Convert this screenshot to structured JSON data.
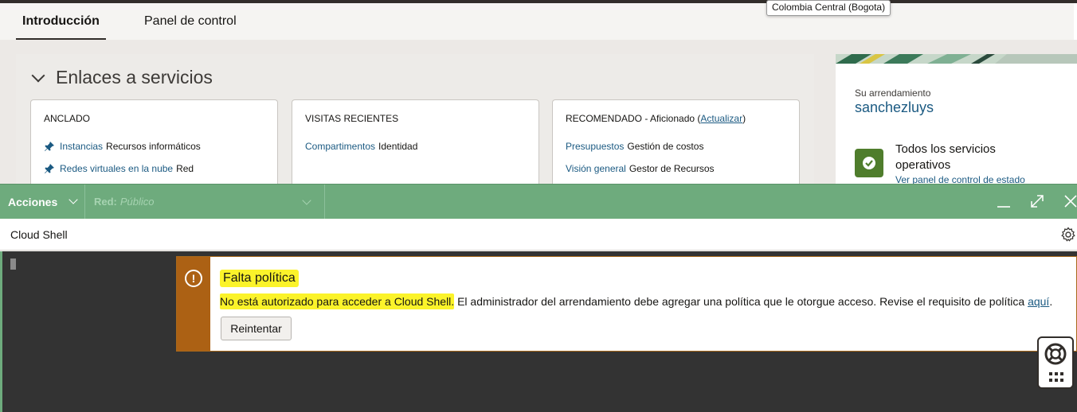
{
  "region_tooltip": "Colombia Central (Bogota)",
  "tabs": [
    {
      "label": "Introducción",
      "active": true
    },
    {
      "label": "Panel de control",
      "active": false
    }
  ],
  "services": {
    "title": "Enlaces a servicios",
    "pinned": {
      "title": "ANCLADO",
      "items": [
        {
          "link": "Instancias",
          "desc": "Recursos informáticos"
        },
        {
          "link": "Redes virtuales en la nube",
          "desc": "Red"
        }
      ]
    },
    "recent": {
      "title": "VISITAS RECIENTES",
      "items": [
        {
          "link": "Compartimentos",
          "desc": "Identidad"
        }
      ]
    },
    "recommended": {
      "title": "RECOMENDADO - Aficionado",
      "update_link": "Actualizar",
      "items": [
        {
          "link": "Presupuestos",
          "desc": "Gestión de costos"
        },
        {
          "link": "Visión general",
          "desc": "Gestor de Recursos"
        }
      ]
    }
  },
  "tenancy": {
    "label": "Su arrendamiento",
    "name": "sanchezluys",
    "status_text": "Todos los servicios operativos",
    "status_link": "Ver panel de control de estado"
  },
  "cloudshell": {
    "actions_label": "Acciones",
    "network_label": "Red:",
    "network_value": "Público",
    "title": "Cloud Shell"
  },
  "alert": {
    "title": "Falta política",
    "message_highlight": "No está autorizado para acceder a Cloud Shell.",
    "message_rest": " El administrador del arrendamiento debe agregar una política que le otorgue acceso. Revise el requisito de política ",
    "message_link": "aquí",
    "message_end": ".",
    "retry_label": "Reintentar"
  },
  "colors": {
    "toolbar": "#6eab7d",
    "alert_side": "#ac6114",
    "highlight": "#fbf32a",
    "link": "#1b5a82",
    "status_ok": "#4f7d2c"
  }
}
